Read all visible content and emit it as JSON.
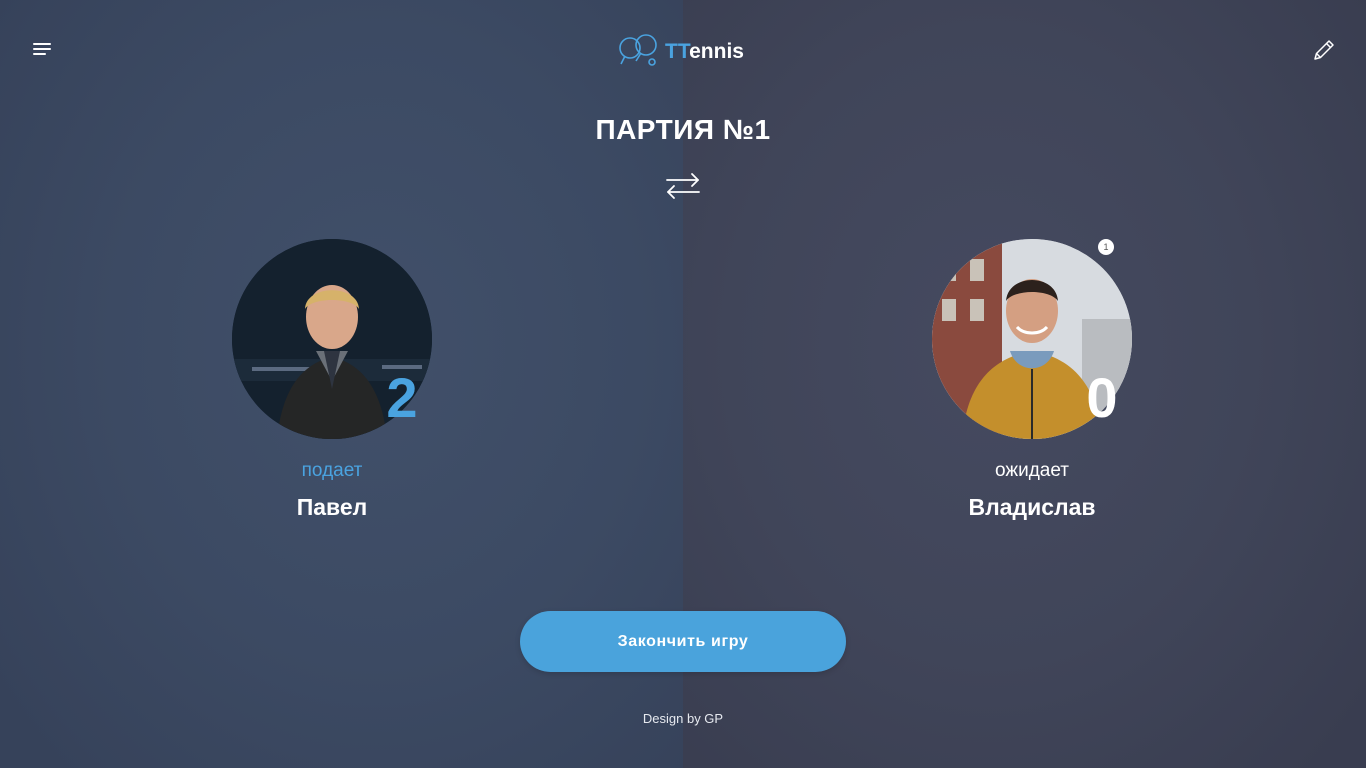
{
  "header": {
    "logo_accent": "TT",
    "logo_rest": "ennis",
    "menu_icon": "hamburger-menu-icon",
    "edit_icon": "pencil-icon",
    "logo_icon": "ping-pong-paddles-icon"
  },
  "game": {
    "title": "ПАРТИЯ №1",
    "swap_icon": "swap-arrows-icon"
  },
  "players": [
    {
      "name": "Павел",
      "status": "подает",
      "score": "2",
      "avatar": "player-photo"
    },
    {
      "name": "Владислав",
      "status": "ожидает",
      "score": "0",
      "badge": "1",
      "avatar": "player-photo"
    }
  ],
  "actions": {
    "end_game_label": "Закончить игру"
  },
  "footer": {
    "credit": "Design by GP"
  },
  "colors": {
    "accent": "#4aa3dc",
    "background_left": "#3c4a63",
    "background_right": "#404559",
    "text": "#ffffff"
  }
}
